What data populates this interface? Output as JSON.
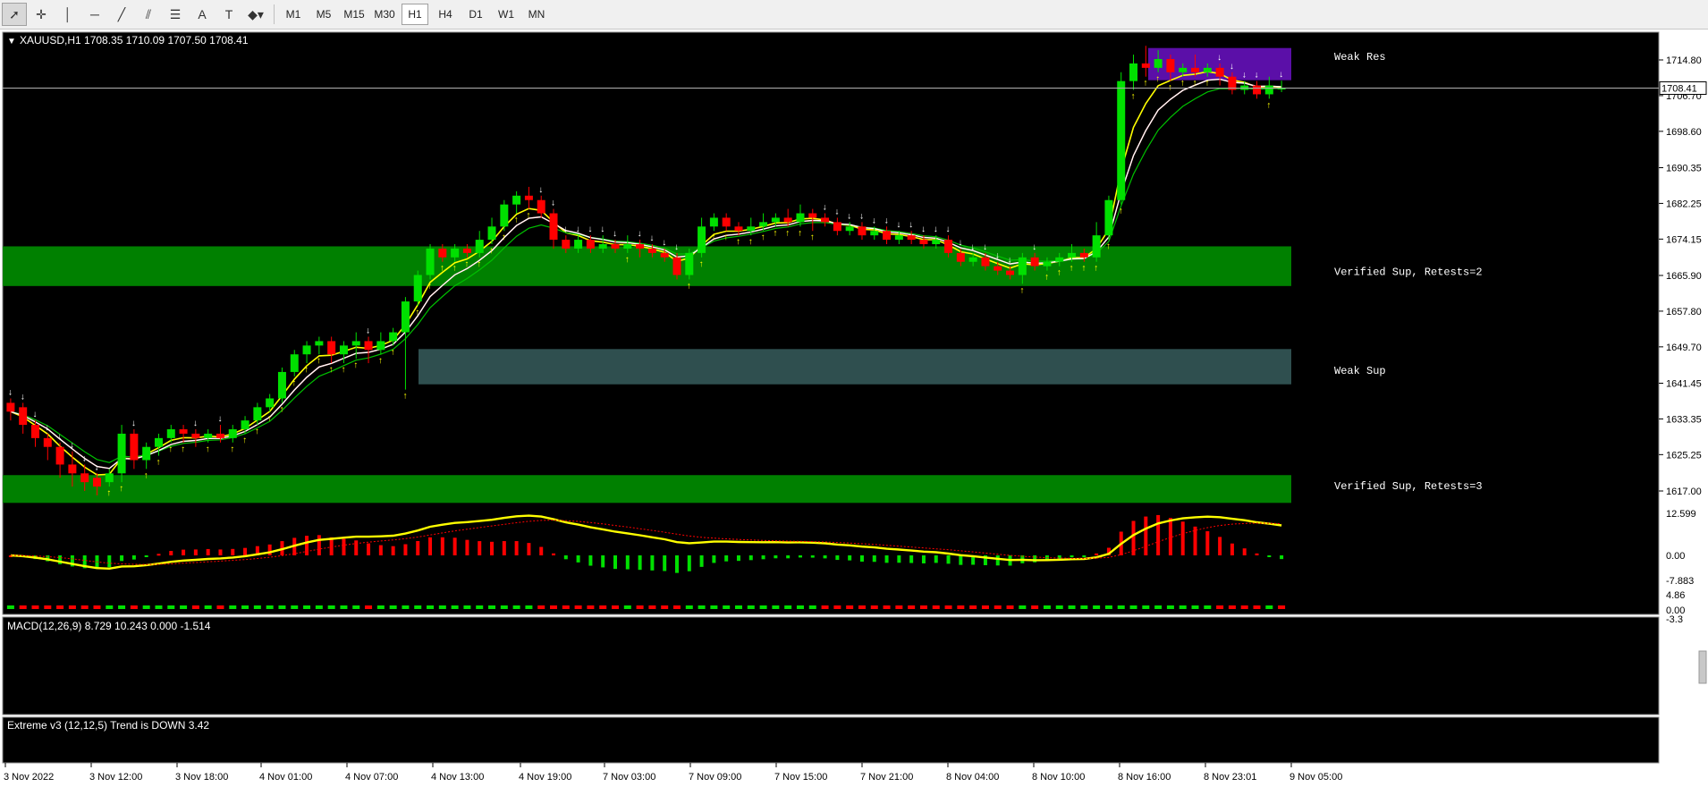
{
  "toolbar": {
    "tools": [
      {
        "name": "cursor-arrow-icon",
        "glyph": "➚",
        "active": true
      },
      {
        "name": "crosshair-icon",
        "glyph": "✛"
      },
      {
        "name": "vertical-line-icon",
        "glyph": "│"
      },
      {
        "name": "horizontal-line-icon",
        "glyph": "─"
      },
      {
        "name": "trendline-icon",
        "glyph": "╱"
      },
      {
        "name": "equidistant-channel-icon",
        "glyph": "⫽"
      },
      {
        "name": "fibonacci-retracement-icon",
        "glyph": "☰"
      },
      {
        "name": "text-icon",
        "glyph": "A"
      },
      {
        "name": "text-label-icon",
        "glyph": "T"
      },
      {
        "name": "shapes-dropdown-icon",
        "glyph": "◆▾"
      }
    ],
    "timeframes": [
      "M1",
      "M5",
      "M15",
      "M30",
      "H1",
      "H4",
      "D1",
      "W1",
      "MN"
    ],
    "active_timeframe": "H1"
  },
  "chart": {
    "symbol_header": "XAUUSD,H1  1708.35 1710.09 1707.50 1708.41",
    "current_price": "1708.41",
    "price_labels": [
      "1714.80",
      "1706.70",
      "1698.60",
      "1690.35",
      "1682.25",
      "1674.15",
      "1665.90",
      "1657.80",
      "1649.70",
      "1641.45",
      "1633.35",
      "1625.25",
      "1617.00"
    ],
    "zones": [
      {
        "label": "Weak Res"
      },
      {
        "label": "Verified Sup, Retests=2"
      },
      {
        "label": "Weak Sup"
      },
      {
        "label": "Verified Sup, Retests=3"
      }
    ],
    "colors": {
      "background": "#000000",
      "bull": "#00e000",
      "bear": "#ff0000",
      "verified_zone": "#008000",
      "weak_sup_zone": "#2f4f4f",
      "weak_res_zone": "#5b0fa8",
      "ma_yellow": "#ffff00",
      "ma_red": "#ff0000",
      "ma_white": "#ffffff",
      "ma_green": "#00c000"
    }
  },
  "macd": {
    "header": "MACD(12,26,9) 8.729 10.243 0.000 -1.514",
    "scale": [
      "12.599",
      "0.00",
      "-7.883"
    ]
  },
  "extreme": {
    "header": "Extreme v3 (12,12,5) Trend is DOWN 3.42",
    "scale": [
      "4.86",
      "0.00",
      "-3.3"
    ]
  },
  "time_axis": [
    "3 Nov 2022",
    "3 Nov 12:00",
    "3 Nov 18:00",
    "4 Nov 01:00",
    "4 Nov 07:00",
    "4 Nov 13:00",
    "4 Nov 19:00",
    "7 Nov 03:00",
    "7 Nov 09:00",
    "7 Nov 15:00",
    "7 Nov 21:00",
    "8 Nov 04:00",
    "8 Nov 10:00",
    "8 Nov 16:00",
    "8 Nov 23:01",
    "9 Nov 05:00"
  ]
}
